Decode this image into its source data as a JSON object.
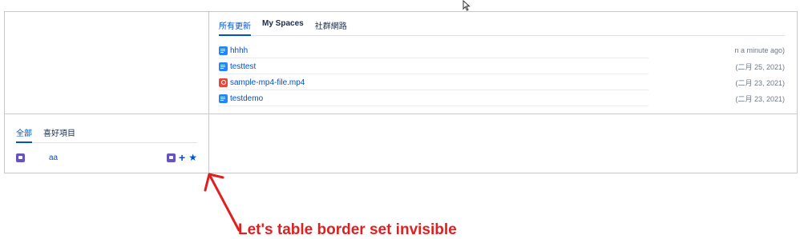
{
  "updates": {
    "tabs": [
      {
        "label": "所有更新",
        "active": true
      },
      {
        "label": "My Spaces",
        "active": false
      },
      {
        "label": "社群網路",
        "active": false
      }
    ],
    "items": [
      {
        "title": "hhhh",
        "time": "n a minute ago)",
        "icon": "page-icon"
      },
      {
        "title": "testtest",
        "time": "(二月 25, 2021)",
        "icon": "page-icon"
      },
      {
        "title": "sample-mp4-file.mp4",
        "time": "(二月 23, 2021)",
        "icon": "media-icon"
      },
      {
        "title": "testdemo",
        "time": "(二月 23, 2021)",
        "icon": "page-icon"
      }
    ]
  },
  "spaces": {
    "tabs": [
      {
        "label": "全部",
        "active": true
      },
      {
        "label": "喜好項目",
        "active": false
      }
    ],
    "items": [
      {
        "name": "aa",
        "icon": "space-icon"
      }
    ]
  },
  "annotation": {
    "text": "Let's table border set invisible",
    "color": "#e02020"
  },
  "colors": {
    "link": "#0052cc",
    "border": "#c8c8c8",
    "page_icon": "#2684ff",
    "media_icon": "#e5493a",
    "space_icon": "#6554c0"
  }
}
